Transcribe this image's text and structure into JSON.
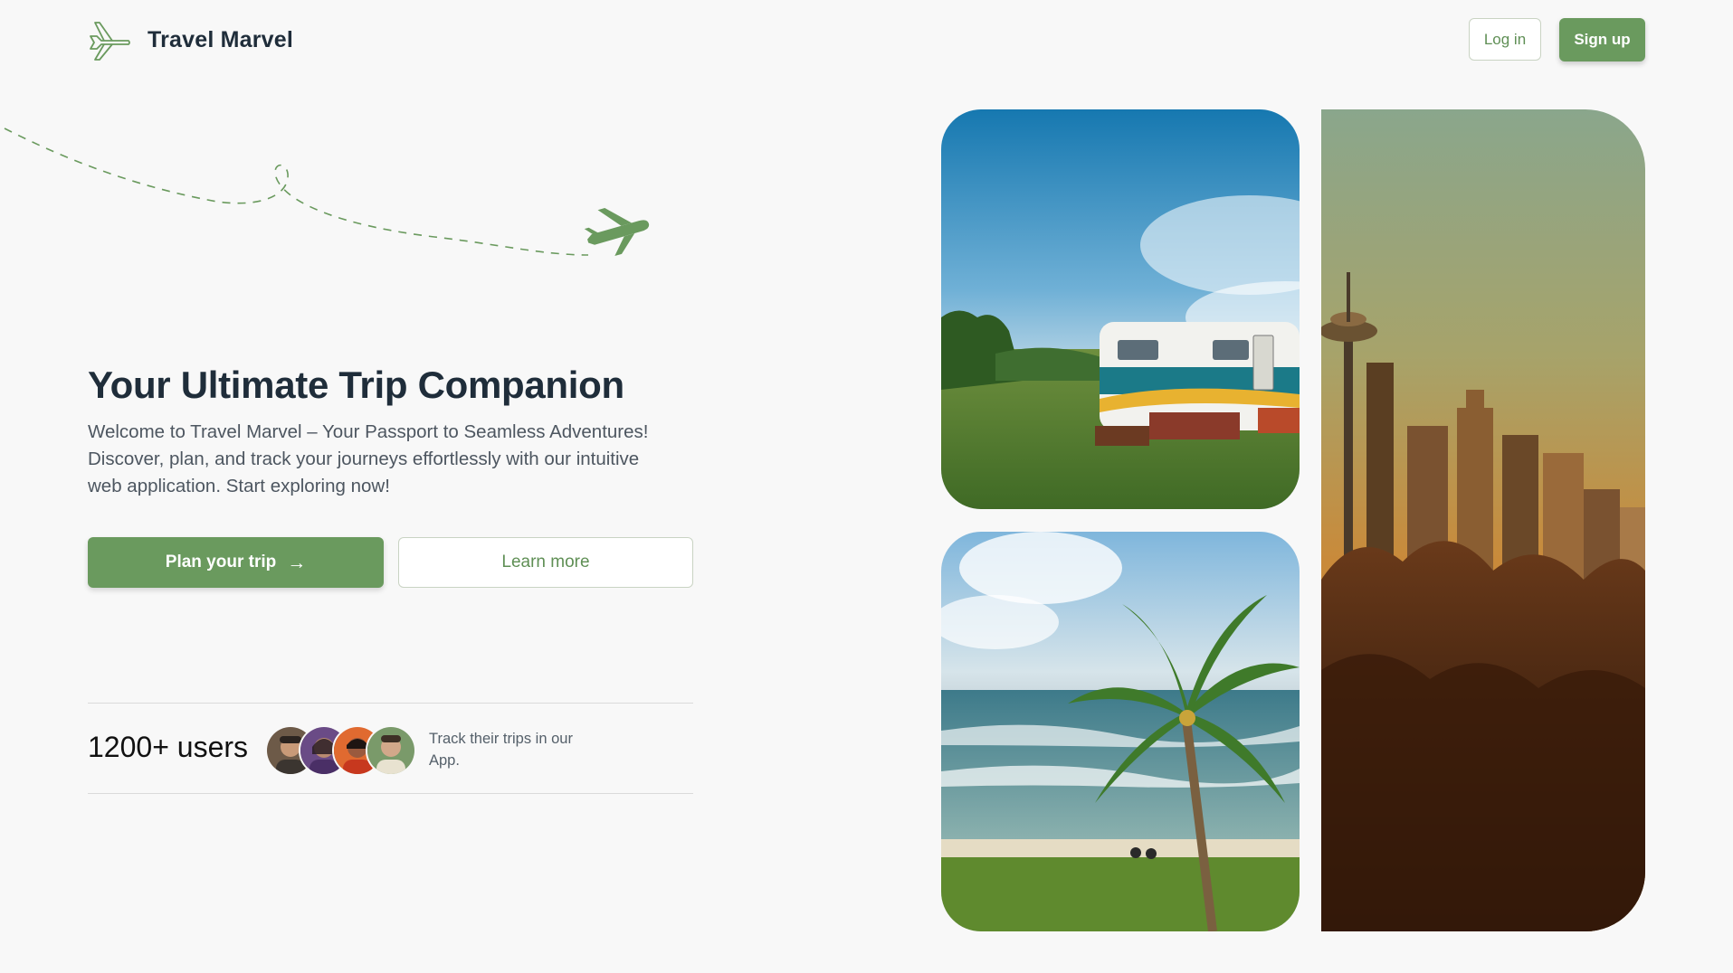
{
  "header": {
    "brand_name": "Travel Marvel",
    "logo_icon": "airplane-icon",
    "login_label": "Log in",
    "signup_label": "Sign up"
  },
  "hero": {
    "title": "Your Ultimate Trip Companion",
    "description": "Welcome to Travel Marvel – Your Passport to Seamless Adventures! Discover, plan, and track your journeys effortlessly with our intuitive web application. Start exploring now!",
    "plan_button_label": "Plan your trip",
    "plan_button_icon": "arrow-right-icon",
    "learn_button_label": "Learn more"
  },
  "users": {
    "count_label": "1200+ users",
    "note": "Track their trips in our App.",
    "avatar_count": 4
  },
  "gallery": {
    "items": [
      "camper-trailer-photo",
      "palm-beach-photo",
      "city-skyline-photo"
    ]
  },
  "colors": {
    "brand_green": "#6a9a5e",
    "text_dark": "#1f2d3a",
    "background": "#f8f8f8"
  }
}
